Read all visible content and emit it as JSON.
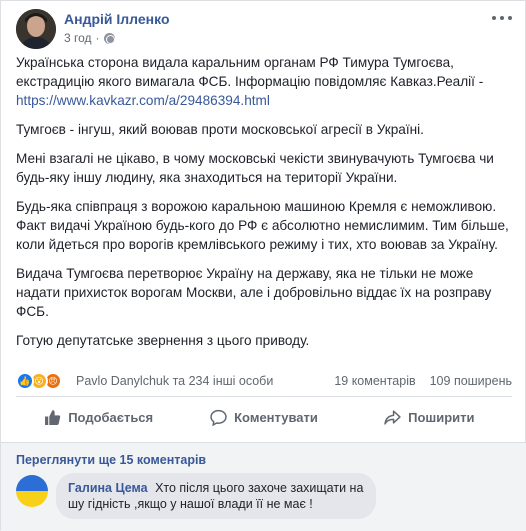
{
  "post": {
    "author": "Андрій Ілленко",
    "time": "3 год",
    "paragraphs": [
      "Українська сторона видала каральним органам РФ Тимура Тумгоєва, екстрадицію якого вимагала ФСБ. Інформацію повідомляє Кавказ.Реалії -",
      "Тумгоєв - інгуш, який воював проти московської агресії в Україні.",
      "Мені взагалі не цікаво, в чому московські чекісти звинувачують Тумгоєва чи будь-яку іншу людину, яка знаходиться на території України.",
      "Будь-яка співпраця з ворожою каральною машиною Кремля є неможливою. Факт видачі Україною будь-кого до РФ є абсолютно немислимим. Тим більше, коли йдеться про ворогів кремлівського режиму і тих, хто воював за Україну.",
      "Видача Тумгоєва перетворює Україну на державу, яка не тільки не може надати прихисток ворогам Москви, але і добровільно віддає їх на розправу ФСБ.",
      "Готую депутатське звернення з цього приводу."
    ],
    "link": "https://www.kavkazr.com/a/29486394.html"
  },
  "stats": {
    "reactions": "Pavlo Danylchuk та 234 інші особи",
    "comments": "19 коментарів",
    "shares": "109 поширень"
  },
  "actions": {
    "like": "Подобається",
    "comment": "Коментувати",
    "share": "Поширити"
  },
  "comments": {
    "view_more": "Переглянути ще 15 коментарів",
    "items": [
      {
        "author": "Галина Цема",
        "text": "Хто після цього захоче захищати на шу гідність ,якщо у нашої влади її не має !"
      }
    ]
  },
  "colors": {
    "link": "#385898",
    "like_blue": "#1877f2",
    "flag_blue": "#2b6ed6",
    "flag_yellow": "#f7d117"
  }
}
